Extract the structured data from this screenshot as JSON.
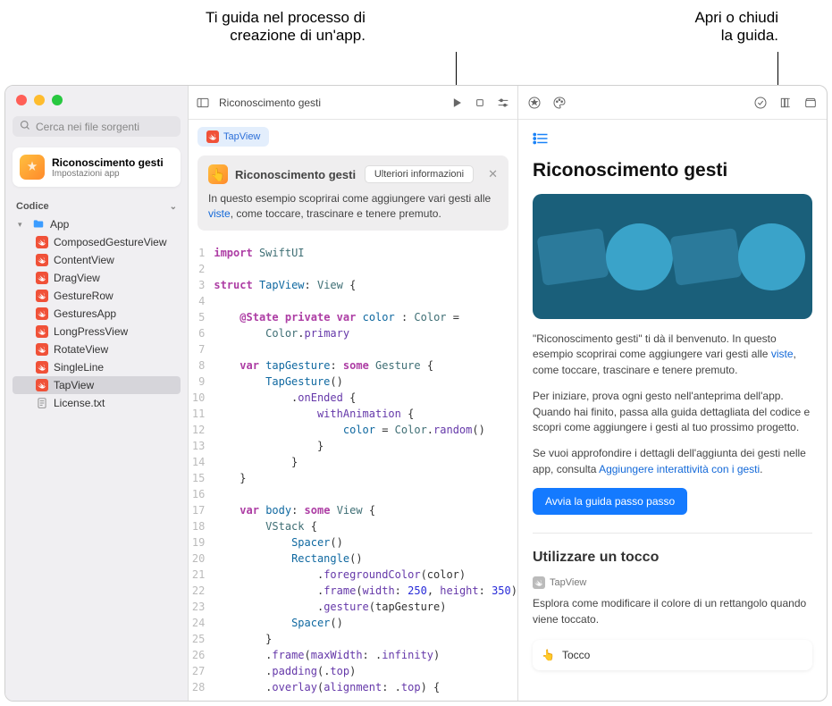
{
  "annotations": {
    "left_l1": "Ti guida nel processo di",
    "left_l2": "creazione di un'app.",
    "right_l1": "Apri o chiudi",
    "right_l2": "la guida."
  },
  "sidebar": {
    "search_placeholder": "Cerca nei file sorgenti",
    "project": {
      "title": "Riconoscimento gesti",
      "subtitle": "Impostazioni app"
    },
    "section_label": "Codice",
    "folder": "App",
    "files": [
      "ComposedGestureView",
      "ContentView",
      "DragView",
      "GestureRow",
      "GesturesApp",
      "LongPressView",
      "RotateView",
      "SingleLine",
      "TapView"
    ],
    "text_file": "License.txt"
  },
  "editor": {
    "breadcrumb": "Riconoscimento gesti",
    "tab": "TapView",
    "banner": {
      "title": "Riconoscimento gesti",
      "button_label": "Ulteriori informazioni",
      "body_pre": "In questo esempio scoprirai come aggiungere vari gesti alle ",
      "body_link": "viste",
      "body_post": ", come toccare, trascinare e tenere premuto."
    },
    "code_lines": [
      "import SwiftUI",
      "",
      "struct TapView: View {",
      "",
      "    @State private var color : Color =",
      "        Color.primary",
      "",
      "    var tapGesture: some Gesture {",
      "        TapGesture()",
      "            .onEnded {",
      "                withAnimation {",
      "                    color = Color.random()",
      "                }",
      "            }",
      "    }",
      "",
      "    var body: some View {",
      "        VStack {",
      "            Spacer()",
      "            Rectangle()",
      "                .foregroundColor(color)",
      "                .frame(width: 250, height: 350)",
      "                .gesture(tapGesture)",
      "            Spacer()",
      "        }",
      "        .frame(maxWidth: .infinity)",
      "        .padding(.top)",
      "        .overlay(alignment: .top) {"
    ]
  },
  "guide": {
    "title": "Riconoscimento gesti",
    "p1_pre": "\"Riconoscimento gesti\" ti dà il benvenuto. In questo esempio scoprirai come aggiungere vari gesti alle ",
    "p1_link": "viste",
    "p1_post": ", come toccare, trascinare e tenere premuto.",
    "p2": "Per iniziare, prova ogni gesto nell'anteprima dell'app. Quando hai finito, passa alla guida dettagliata del codice e scopri come aggiungere i gesti al tuo prossimo progetto.",
    "p3_pre": "Se vuoi approfondire i dettagli dell'aggiunta dei gesti nelle app, consulta ",
    "p3_link": "Aggiungere interattività con i gesti",
    "p3_post": ".",
    "cta_button": "Avvia la guida passo passo",
    "section2_title": "Utilizzare un tocco",
    "section2_tapview": "TapView",
    "section2_desc": "Esplora come modificare il colore di un rettangolo quando viene toccato.",
    "section2_card": "Tocco"
  }
}
